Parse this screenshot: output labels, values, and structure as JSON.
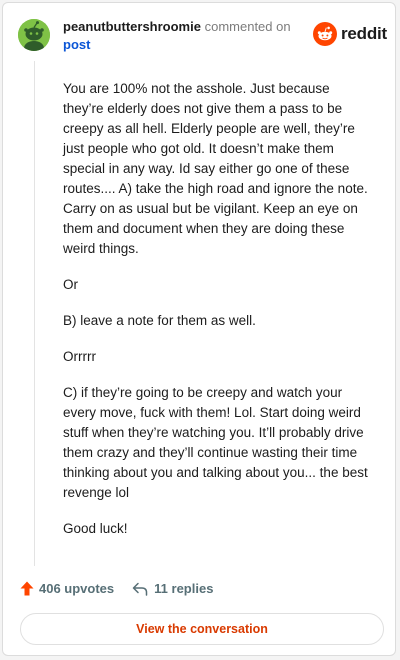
{
  "header": {
    "username": "peanutbuttershroomie",
    "action": "commented on",
    "link": "post"
  },
  "logo": {
    "word": "reddit",
    "accent": "#ff4500",
    "icon": "reddit-alien-icon"
  },
  "comment": {
    "paragraphs": [
      "You are 100% not the asshole. Just because they’re elderly does not give them a pass to be creepy as all hell. Elderly people are well, they’re just people who got old. It doesn’t make them special in any way. Id say either go one of these routes.... A) take the high road and ignore the note. Carry on as usual but be vigilant. Keep an eye on them and document when they are doing these weird things.",
      "Or",
      "B) leave a note for them as well.",
      "Orrrrr",
      "C) if they’re going to be creepy and watch your every move, fuck with them! Lol. Start doing weird stuff when they’re watching you. It’ll probably drive them crazy and they’ll continue wasting their time thinking about you and talking about you... the best revenge lol",
      "Good luck!"
    ]
  },
  "footer": {
    "upvotes": "406 upvotes",
    "replies": "11 replies",
    "upvote_color": "#ff4500",
    "upvote_icon": "upvote-arrow-icon",
    "reply_icon": "reply-arrow-icon"
  },
  "cta": {
    "label": "View the conversation",
    "color": "#d93a00"
  }
}
